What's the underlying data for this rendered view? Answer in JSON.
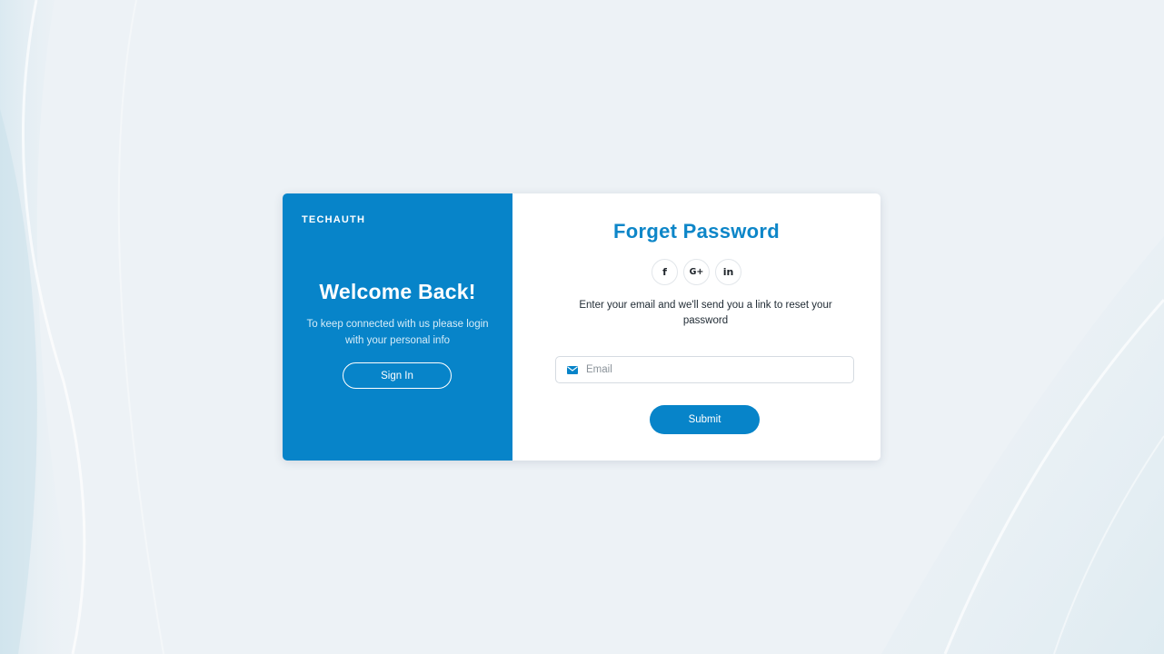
{
  "colors": {
    "background": "#edf2f6",
    "brand_blue": "#0784c9",
    "title_blue": "#0d86c8",
    "card": "#ffffff"
  },
  "left_panel": {
    "brand": "TECHAUTH",
    "heading": "Welcome Back!",
    "subtext": "To keep connected with us please login with your personal info",
    "signin_label": "Sign In"
  },
  "right_panel": {
    "title": "Forget Password",
    "socials": [
      {
        "icon": "facebook-icon",
        "glyph": "f"
      },
      {
        "icon": "google-plus-icon",
        "glyph": "G+"
      },
      {
        "icon": "linkedin-icon",
        "glyph": "in"
      }
    ],
    "instruction": "Enter your email and we'll send you a link to reset your password",
    "email": {
      "icon": "mail-icon",
      "placeholder": "Email",
      "value": ""
    },
    "submit_label": "Submit"
  }
}
